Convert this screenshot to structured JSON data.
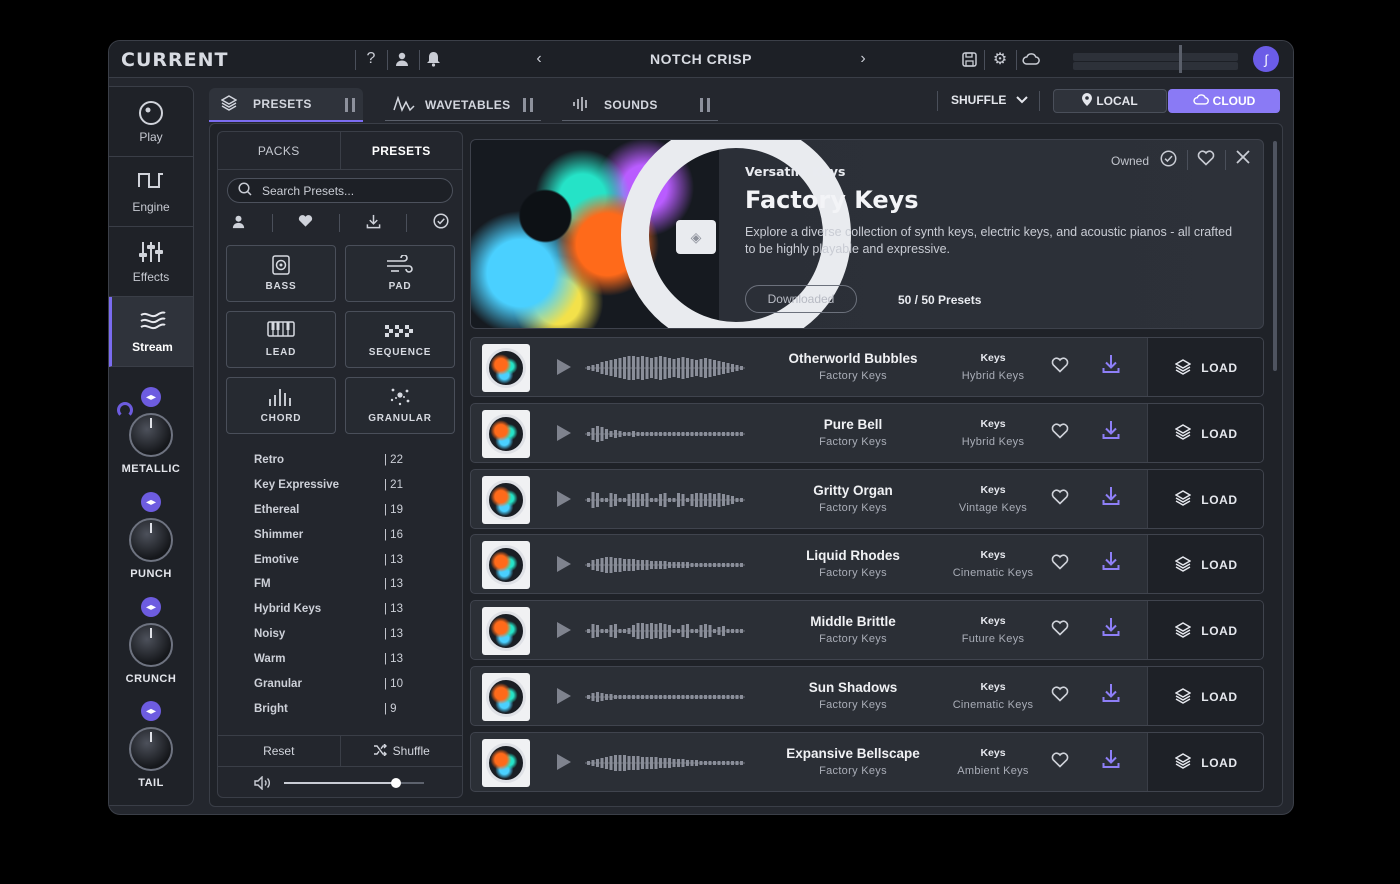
{
  "app": {
    "logo": "CURRENT",
    "preset_title": "NOTCH CRISP",
    "accent": "#7b6cf0"
  },
  "topbar": {
    "icons": [
      "help-icon",
      "user-icon",
      "bell-icon",
      "chevron-left-icon",
      "chevron-right-icon",
      "save-icon",
      "gear-icon",
      "cloud-icon"
    ]
  },
  "nav": {
    "items": [
      {
        "label": "Play",
        "icon": "play-dial-icon"
      },
      {
        "label": "Engine",
        "icon": "engine-wave-icon"
      },
      {
        "label": "Effects",
        "icon": "sliders-icon"
      },
      {
        "label": "Stream",
        "icon": "stream-icon"
      }
    ],
    "active": "Stream"
  },
  "macros": [
    {
      "label": "METALLIC"
    },
    {
      "label": "PUNCH"
    },
    {
      "label": "CRUNCH"
    },
    {
      "label": "TAIL"
    }
  ],
  "tabs": [
    {
      "label": "PRESETS"
    },
    {
      "label": "WAVETABLES"
    },
    {
      "label": "SOUNDS"
    }
  ],
  "toolbar": {
    "shuffle_label": "SHUFFLE",
    "local_label": "LOCAL",
    "cloud_label": "CLOUD"
  },
  "filters": {
    "seg": [
      "PACKS",
      "PRESETS"
    ],
    "search_placeholder": "Search Presets...",
    "categories": [
      "BASS",
      "PAD",
      "LEAD",
      "SEQUENCE",
      "CHORD",
      "GRANULAR"
    ],
    "tags": [
      {
        "name": "Retro",
        "count": "| 22"
      },
      {
        "name": "Key Expressive",
        "count": "| 21"
      },
      {
        "name": "Ethereal",
        "count": "| 19"
      },
      {
        "name": "Shimmer",
        "count": "| 16"
      },
      {
        "name": "Emotive",
        "count": "| 13"
      },
      {
        "name": "FM",
        "count": "| 13"
      },
      {
        "name": "Hybrid Keys",
        "count": "| 13"
      },
      {
        "name": "Noisy",
        "count": "| 13"
      },
      {
        "name": "Warm",
        "count": "| 13"
      },
      {
        "name": "Granular",
        "count": "| 10"
      },
      {
        "name": "Bright",
        "count": "| 9"
      }
    ],
    "reset_label": "Reset",
    "shuffle_label": "Shuffle",
    "volume": 0.8
  },
  "pack": {
    "subtitle": "Versatile Keys",
    "title": "Factory Keys",
    "description": "Explore a diverse collection of synth keys, electric keys, and acoustic pianos - all crafted to be highly playable and expressive.",
    "status_button": "Downloaded",
    "count": "50 / 50 Presets",
    "owned_label": "Owned"
  },
  "presets": [
    {
      "name": "Otherworld Bubbles",
      "pack": "Factory Keys",
      "type": "Keys",
      "sub": "Hybrid Keys",
      "load": "LOAD"
    },
    {
      "name": "Pure Bell",
      "pack": "Factory Keys",
      "type": "Keys",
      "sub": "Hybrid Keys",
      "load": "LOAD"
    },
    {
      "name": "Gritty Organ",
      "pack": "Factory Keys",
      "type": "Keys",
      "sub": "Vintage Keys",
      "load": "LOAD"
    },
    {
      "name": "Liquid Rhodes",
      "pack": "Factory Keys",
      "type": "Keys",
      "sub": "Cinematic Keys",
      "load": "LOAD"
    },
    {
      "name": "Middle Brittle",
      "pack": "Factory Keys",
      "type": "Keys",
      "sub": "Future Keys",
      "load": "LOAD"
    },
    {
      "name": "Sun Shadows",
      "pack": "Factory Keys",
      "type": "Keys",
      "sub": "Cinematic Keys",
      "load": "LOAD"
    },
    {
      "name": "Expansive Bellscape",
      "pack": "Factory Keys",
      "type": "Keys",
      "sub": "Ambient Keys",
      "load": "LOAD"
    }
  ]
}
